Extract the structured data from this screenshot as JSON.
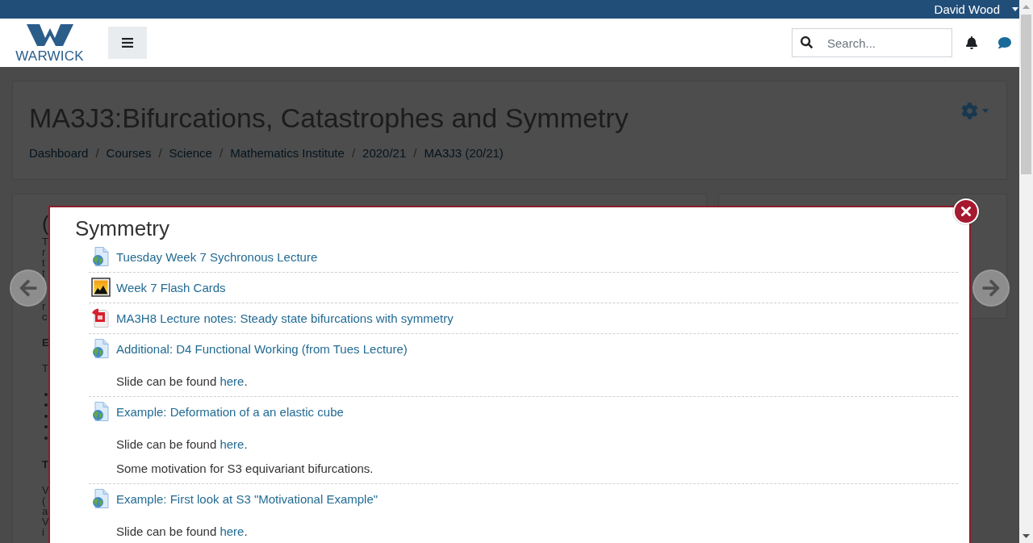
{
  "top_bar": {
    "user_name": "David Wood"
  },
  "navbar": {
    "logo_text": "WARWICK",
    "search": {
      "placeholder": "Search..."
    }
  },
  "course_header": {
    "title": "MA3J3:Bifurcations, Catastrophes and Symmetry",
    "breadcrumbs": {
      "separator": "/",
      "items": [
        "Dashboard",
        "Courses",
        "Science",
        "Mathematics Institute",
        "2020/21",
        "MA3J3 (20/21)"
      ]
    }
  },
  "course_content": {
    "heading": "(",
    "blocks": [
      {
        "kind": "paragraph",
        "lines": [
          "T",
          "r",
          "t",
          "t"
        ]
      },
      {
        "kind": "paragraph",
        "lines": [
          "r",
          "c"
        ]
      },
      {
        "kind": "bold",
        "lines": [
          "E"
        ]
      },
      {
        "kind": "paragraph",
        "lines": [
          "T"
        ]
      },
      {
        "kind": "bullet"
      },
      {
        "kind": "bullet"
      },
      {
        "kind": "bullet"
      },
      {
        "kind": "bullet"
      },
      {
        "kind": "bullet"
      },
      {
        "kind": "bold",
        "lines": [
          "T"
        ]
      },
      {
        "kind": "paragraph",
        "lines": [
          "V",
          "(",
          "a",
          "V",
          "i"
        ]
      }
    ]
  },
  "modal": {
    "title": "Symmetry",
    "activities": [
      {
        "kind": "url",
        "title": "Tuesday Week 7 Sychronous Lecture"
      },
      {
        "kind": "image",
        "title": "Week 7 Flash Cards"
      },
      {
        "kind": "pdf",
        "title": "MA3H8 Lecture notes: Steady state bifurcations with symmetry"
      },
      {
        "kind": "url",
        "title": "Additional: D4 Functional Working (from Tues Lecture)",
        "descriptions": [
          {
            "parts": [
              {
                "kind": "text",
                "text": "Slide can be found "
              },
              {
                "kind": "link",
                "text": "here"
              },
              {
                "kind": "text",
                "text": "."
              }
            ]
          }
        ]
      },
      {
        "kind": "url",
        "title": "Example: Deformation of a an elastic cube",
        "descriptions": [
          {
            "parts": [
              {
                "kind": "text",
                "text": "Slide can be found "
              },
              {
                "kind": "link",
                "text": "here"
              },
              {
                "kind": "text",
                "text": "."
              }
            ]
          },
          {
            "parts": [
              {
                "kind": "text",
                "text": "Some motivation for S3 equivariant bifurcations."
              }
            ]
          }
        ]
      },
      {
        "kind": "url",
        "title": "Example: First look at S3 \"Motivational Example\"",
        "descriptions": [
          {
            "parts": [
              {
                "kind": "text",
                "text": "Slide can be found "
              },
              {
                "kind": "link",
                "text": "here"
              },
              {
                "kind": "text",
                "text": "."
              }
            ]
          }
        ]
      }
    ]
  }
}
